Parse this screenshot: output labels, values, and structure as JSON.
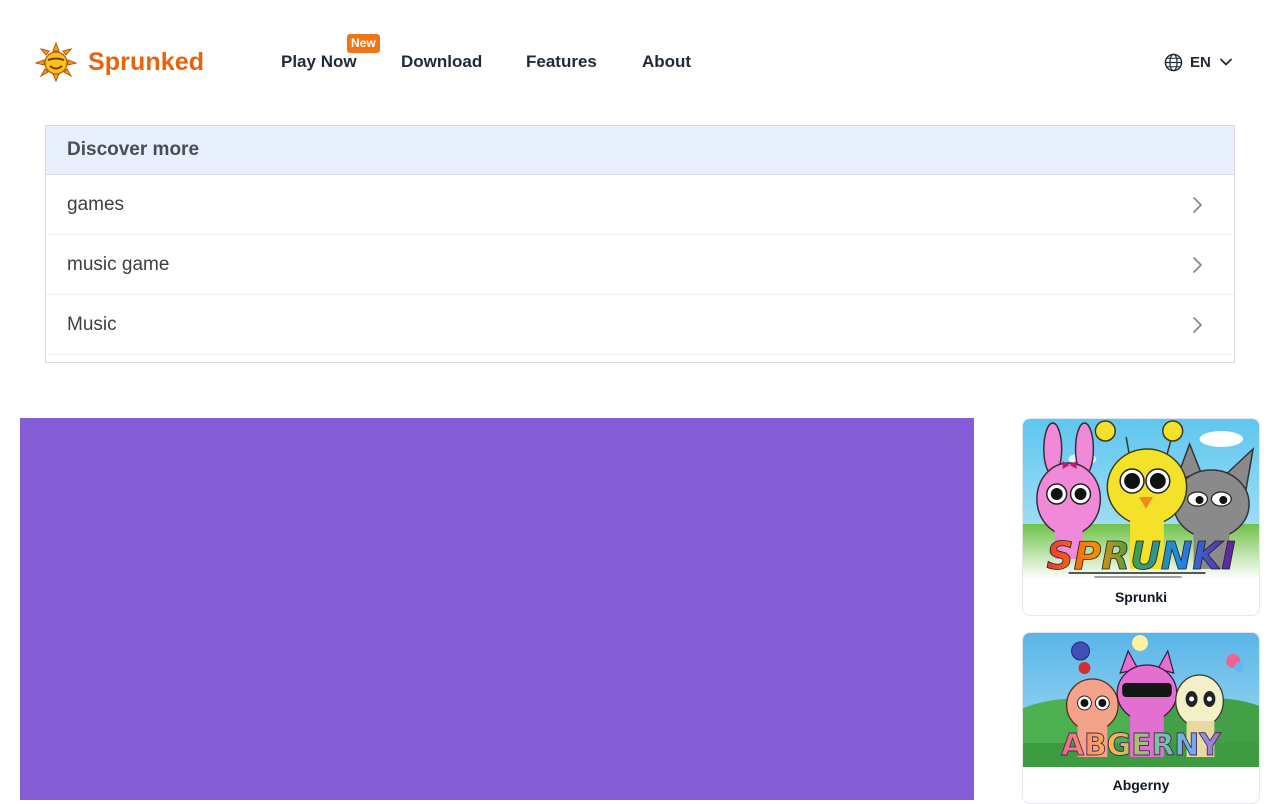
{
  "brand": {
    "name": "Sprunked",
    "logo_icon": "sun-mascot-icon"
  },
  "nav": {
    "items": [
      {
        "label": "Play Now",
        "badge": "New"
      },
      {
        "label": "Download"
      },
      {
        "label": "Features"
      },
      {
        "label": "About"
      }
    ]
  },
  "language": {
    "icon": "globe-icon",
    "label": "EN",
    "caret_icon": "chevron-down-icon"
  },
  "discover": {
    "title": "Discover more",
    "items": [
      {
        "label": "games",
        "icon": "chevron-right-icon"
      },
      {
        "label": "music game",
        "icon": "chevron-right-icon"
      },
      {
        "label": "Music",
        "icon": "chevron-right-icon"
      }
    ]
  },
  "game_embed": {
    "background": "#855dd6"
  },
  "sidebar": {
    "cards": [
      {
        "title": "Sprunki",
        "thumb_text": "SPRUNKI"
      },
      {
        "title": "Abgerny",
        "thumb_text": "ABGERNY"
      }
    ]
  },
  "colors": {
    "brand": "#e8630a",
    "badge": "#f07519",
    "discover_header": "#e8f0fd",
    "text": "#1f2937"
  }
}
